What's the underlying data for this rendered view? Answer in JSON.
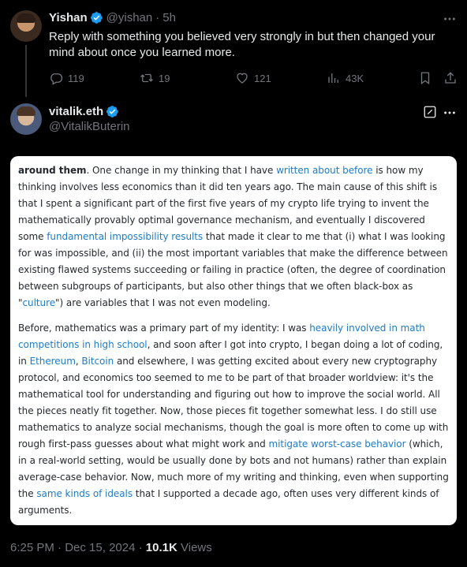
{
  "reply": {
    "name": "Yishan",
    "handle": "@yishan",
    "time": "5h",
    "separator": "·",
    "text": "Reply with something you believed very strongly in but then changed your mind about once you learned more.",
    "actions": {
      "replies": "119",
      "reposts": "19",
      "likes": "121",
      "views": "43K"
    }
  },
  "main": {
    "name": "vitalik.eth",
    "handle": "@VitalikButerin"
  },
  "card": {
    "p1": [
      {
        "t": "around them",
        "b": true
      },
      {
        "t": ". One change in my thinking that I have "
      },
      {
        "t": "written about before",
        "link": true
      },
      {
        "t": " is how my thinking involves less economics than it did ten years ago. The main cause of this shift is that I spent a significant part of the first five years of my crypto life trying to invent the mathematically provably optimal governance mechanism, and eventually I discovered some "
      },
      {
        "t": "fundamental impossibility results",
        "link": true
      },
      {
        "t": " that made it clear to me that (i) what I was looking for was impossible, and (ii) the most important variables that make the difference between existing flawed systems succeeding or failing in practice (often, the degree of coordination between subgroups of participants, but also other things that we often black-box as \""
      },
      {
        "t": "culture",
        "link": true
      },
      {
        "t": "\") are variables that I was not even modeling."
      }
    ],
    "p2": [
      {
        "t": "Before, mathematics was a primary part of my identity: I was "
      },
      {
        "t": "heavily involved in math competitions in high school",
        "link": true
      },
      {
        "t": ", and soon after I got into crypto, I began doing a lot of coding, in "
      },
      {
        "t": "Ethereum",
        "link": true
      },
      {
        "t": ", "
      },
      {
        "t": "Bitcoin",
        "link": true
      },
      {
        "t": " and elsewhere, I was getting excited about every new cryptography protocol, and economics too seemed to me to be part of that broader worldview: it's the mathematical tool for understanding and figuring out how to improve the social world. All the pieces neatly fit together. Now, those pieces fit together somewhat less. I do still use mathematics to analyze social mechanisms, though the goal is more often to come up with rough first-pass guesses about what might work and "
      },
      {
        "t": "mitigate worst-case behavior",
        "link": true
      },
      {
        "t": " (which, in a real-world setting, would be usually done by bots and not humans) rather than explain average-case behavior. Now, much more of my writing and thinking, even when supporting the "
      },
      {
        "t": "same kinds of ideals",
        "link": true
      },
      {
        "t": " that I supported a decade ago, often uses very different kinds of arguments."
      }
    ]
  },
  "meta": {
    "time": "6:25 PM",
    "date": "Dec 15, 2024",
    "dot": "·",
    "views_count": "10.1K",
    "views_label": "Views"
  },
  "colors": {
    "background": "#000000",
    "verified": "#1d9bf0",
    "link": "#1f7bc4",
    "muted": "#71767b"
  },
  "icons": [
    "verified-badge-icon",
    "reply-icon",
    "repost-icon",
    "like-icon",
    "views-icon",
    "bookmark-icon",
    "share-icon",
    "more-icon",
    "edit-icon"
  ]
}
